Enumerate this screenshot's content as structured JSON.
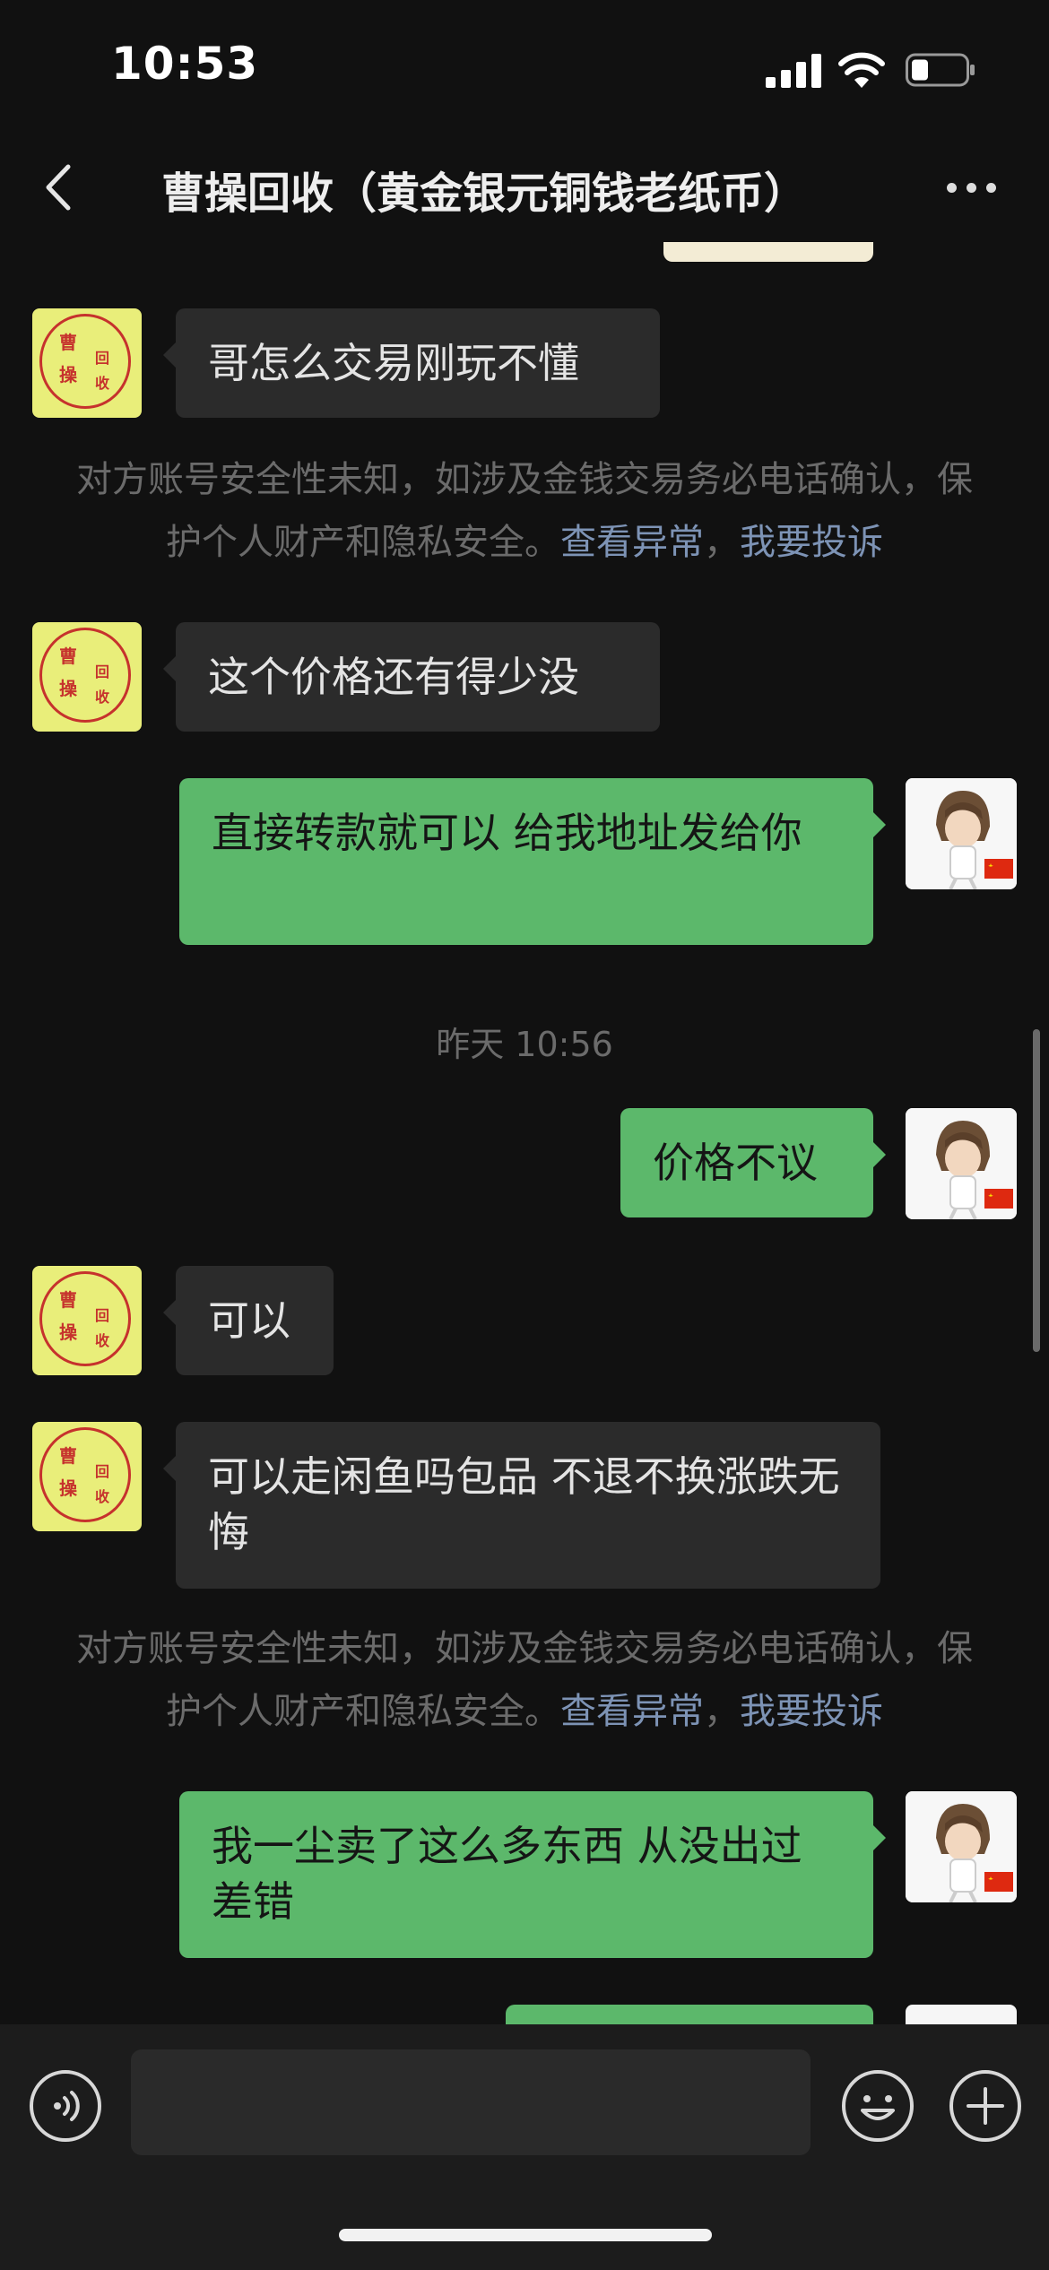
{
  "status_bar": {
    "time": "10:53"
  },
  "header": {
    "title": "曹操回收（黄金银元铜钱老纸币）"
  },
  "avatar_text": [
    "曹",
    "操",
    "回",
    "收"
  ],
  "messages": [
    {
      "from": "contact",
      "text": "哥怎么交易刚玩不懂"
    },
    {
      "type": "notice",
      "text": "对方账号安全性未知，如涉及金钱交易务必电话确认，保护个人财产和隐私安全。",
      "link1": "查看异常",
      "sep": "，",
      "link2": "我要投诉"
    },
    {
      "from": "contact",
      "text": "这个价格还有得少没"
    },
    {
      "from": "me",
      "text": "直接转款就可以  给我地址发给你"
    },
    {
      "type": "time",
      "text": "昨天 10:56"
    },
    {
      "from": "me",
      "text": "价格不议"
    },
    {
      "from": "contact",
      "text": "可以"
    },
    {
      "from": "contact",
      "text": "可以走闲鱼吗包品   不退不换涨跌无悔"
    },
    {
      "type": "notice",
      "text": "对方账号安全性未知，如涉及金钱交易务必电话确认，保护个人财产和隐私安全。",
      "link1": "查看异常",
      "sep": "，",
      "link2": "我要投诉"
    },
    {
      "from": "me",
      "text": "我一尘卖了这么多东西  从没出过差错"
    }
  ],
  "colors": {
    "outgoing_bubble": "#5cb86b",
    "incoming_bubble": "#2b2b2b",
    "background": "#111111",
    "notice_link": "#7d93b5"
  },
  "icons": [
    "signal-icon",
    "wifi-icon",
    "battery-icon",
    "back-chevron-icon",
    "more-dots-icon",
    "voice-icon",
    "emoji-icon",
    "plus-icon"
  ]
}
